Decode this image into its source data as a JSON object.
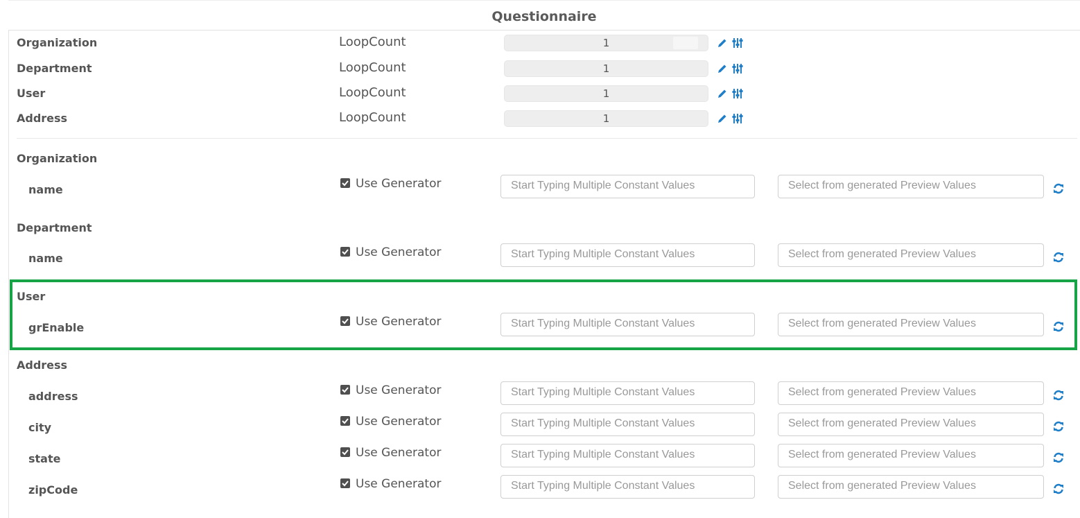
{
  "title": "Questionnaire",
  "loop_counts": [
    {
      "entity": "Organization",
      "label": "LoopCount",
      "value": "1"
    },
    {
      "entity": "Department",
      "label": "LoopCount",
      "value": "1"
    },
    {
      "entity": "User",
      "label": "LoopCount",
      "value": "1"
    },
    {
      "entity": "Address",
      "label": "LoopCount",
      "value": "1"
    }
  ],
  "groups": [
    {
      "name": "Organization",
      "fields": [
        {
          "name": "name"
        }
      ]
    },
    {
      "name": "Department",
      "fields": [
        {
          "name": "name"
        }
      ]
    },
    {
      "name": "User",
      "highlighted": true,
      "fields": [
        {
          "name": "grEnable"
        }
      ]
    },
    {
      "name": "Address",
      "fields": [
        {
          "name": "address"
        },
        {
          "name": "city"
        },
        {
          "name": "state"
        },
        {
          "name": "zipCode"
        }
      ]
    }
  ],
  "field_controls": {
    "use_generator_label": "Use Generator",
    "use_generator_checked": true,
    "constant_placeholder": "Start Typing Multiple Constant Values",
    "preview_placeholder": "Select from generated Preview Values"
  },
  "colors": {
    "accent_blue": "#1f7ec8",
    "highlight_green": "#17a447"
  },
  "icons": {
    "edit": "pencil-icon",
    "settings": "sliders-icon",
    "refresh": "refresh-icon"
  }
}
